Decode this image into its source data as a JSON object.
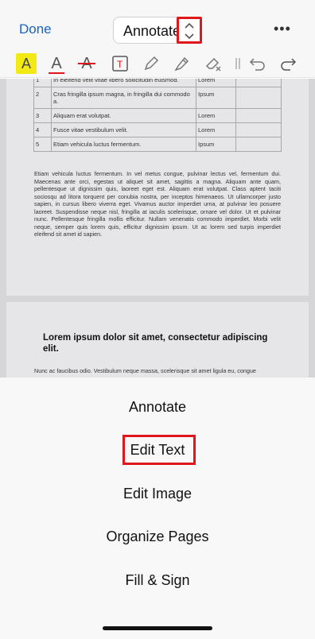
{
  "header": {
    "done_label": "Done",
    "mode_label": "Annotate",
    "more_label": "•••"
  },
  "toolbar": {
    "highlight_glyph": "A",
    "underline_glyph": "A",
    "strike_glyph": "A",
    "icons": [
      "highlight-icon",
      "underline-icon",
      "strikethrough-icon",
      "text-box-icon",
      "pen-icon",
      "marker-icon",
      "eraser-icon",
      "separator-icon",
      "undo-icon",
      "redo-icon"
    ],
    "accent_color": "#e0161d",
    "highlight_color": "#f3ea15"
  },
  "document": {
    "table_rows": [
      {
        "num": "1",
        "text": "In eleifend velit vitae libero sollicitudin euismod.",
        "label": "Lorem"
      },
      {
        "num": "2",
        "text": "Cras fringilla ipsum magna, in fringilla dui commodo a.",
        "label": "Ipsum"
      },
      {
        "num": "3",
        "text": "Aliquam erat volutpat.",
        "label": "Lorem"
      },
      {
        "num": "4",
        "text": "Fusce vitae vestibulum velit.",
        "label": "Lorem"
      },
      {
        "num": "5",
        "text": "Etiam vehicula luctus fermentum.",
        "label": "Ipsum"
      }
    ],
    "paragraph": "Etiam vehicula luctus fermentum. In vel metus congue, pulvinar lectus vel, fermentum dui. Maecenas ante orci, egestas ut aliquet sit amet, sagittis a magna. Aliquam ante quam, pellentesque ut dignissim quis, laoreet eget est. Aliquam erat volutpat. Class aptent taciti sociosqu ad litora torquent per conubia nostra, per inceptos himenaeos. Ut ullamcorper justo sapien, in cursus libero viverra eget. Vivamus auctor imperdiet urna, at pulvinar leo posuere laoreet. Suspendisse neque nisl, fringilla at iaculis scelerisque, ornare vel dolor. Ut et pulvinar nunc. Pellentesque fringilla mollis efficitur. Nullam venenatis commodo imperdiet. Morbi velit neque, semper quis lorem quis, efficitur dignissim ipsum. Ut ac lorem sed turpis imperdiet eleifend sit amet id sapien.",
    "heading": "Lorem ipsum dolor sit amet, consectetur adipiscing elit.",
    "paragraph2": "Nunc ac faucibus odio. Vestibulum neque massa, scelerisque sit amet ligula eu, congue"
  },
  "menu": {
    "items": [
      "Annotate",
      "Edit Text",
      "Edit Image",
      "Organize Pages",
      "Fill & Sign"
    ]
  }
}
